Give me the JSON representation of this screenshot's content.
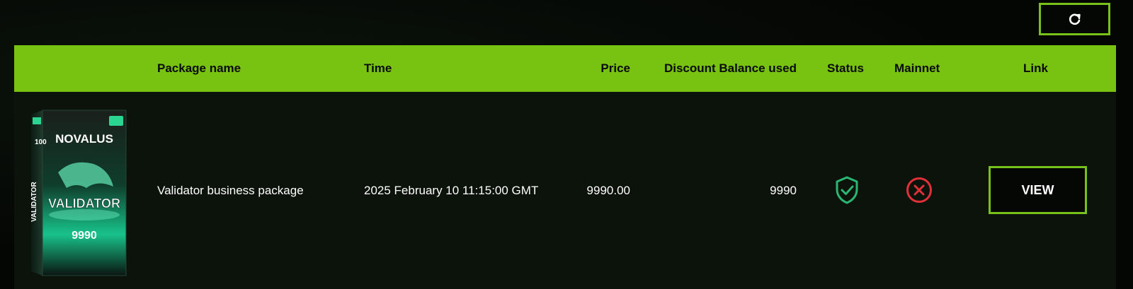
{
  "toolbar": {
    "refresh_icon": "refresh-icon"
  },
  "table": {
    "columns": [
      "Package name",
      "Time",
      "Price",
      "Discount Balance used",
      "Status",
      "Mainnet",
      "Link"
    ],
    "rows": [
      {
        "package_name": "Validator business package",
        "time": "2025 February 10 11:15:00 GMT",
        "price": "9990.00",
        "discount_balance_used": "9990",
        "status_icon": "shield-check-icon",
        "mainnet_icon": "x-circle-icon",
        "link_label": "VIEW",
        "thumbnail": {
          "brand": "NOVALUS",
          "title": "VALIDATOR",
          "value": "9990",
          "side_number": "100",
          "badge": "9990"
        }
      }
    ]
  },
  "colors": {
    "accent": "#78c211",
    "status_ok": "#2bb673",
    "status_fail": "#e0303a",
    "background": "#050705"
  }
}
